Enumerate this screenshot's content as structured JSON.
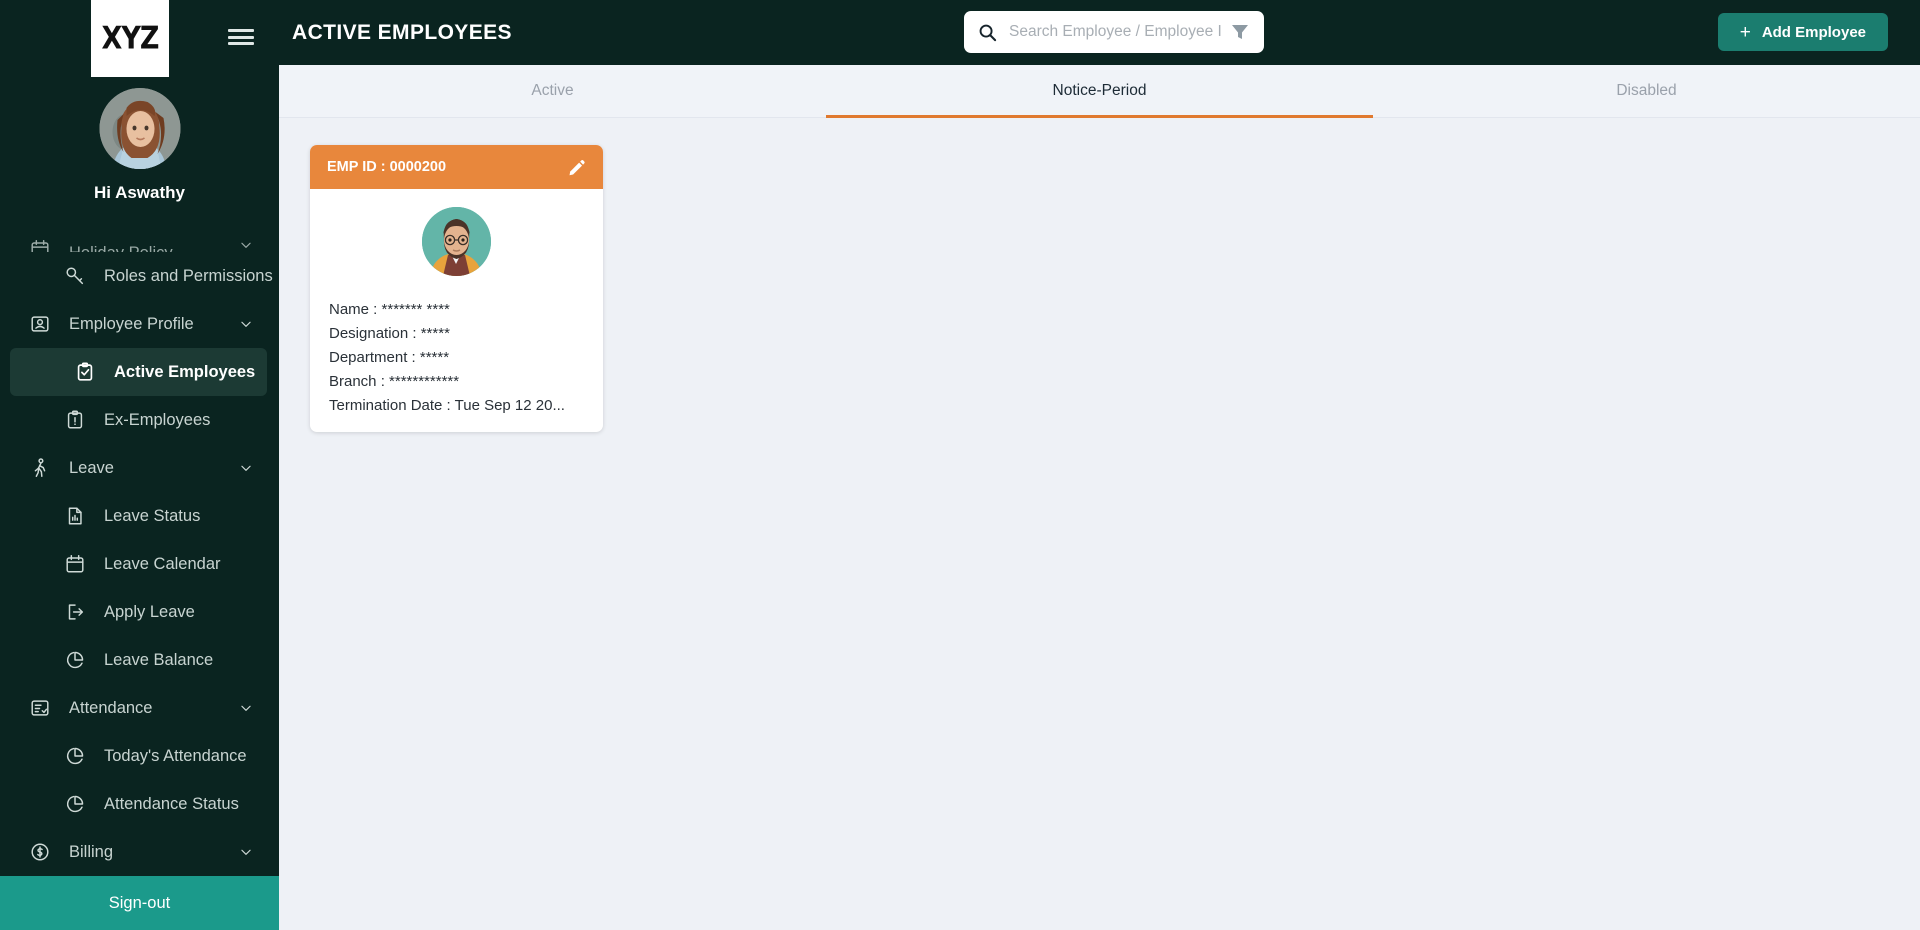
{
  "brand": {
    "logo_text": "XYZ"
  },
  "sidebar": {
    "greeting": "Hi Aswathy",
    "items": [
      {
        "label": "Holiday Policy",
        "icon": "calendar-icon",
        "level": "parent",
        "state": "clipped",
        "chevron": true
      },
      {
        "label": "Roles and Permissions",
        "icon": "key-icon",
        "level": "child",
        "state": "normal",
        "chevron": false
      },
      {
        "label": "Employee Profile",
        "icon": "id-card-icon",
        "level": "parent",
        "state": "normal",
        "chevron": true
      },
      {
        "label": "Active Employees",
        "icon": "clipboard-check-icon",
        "level": "child",
        "state": "active",
        "chevron": false
      },
      {
        "label": "Ex-Employees",
        "icon": "clipboard-alert-icon",
        "level": "child",
        "state": "normal",
        "chevron": false
      },
      {
        "label": "Leave",
        "icon": "walking-person-icon",
        "level": "parent",
        "state": "normal",
        "chevron": true
      },
      {
        "label": "Leave Status",
        "icon": "document-chart-icon",
        "level": "child",
        "state": "normal",
        "chevron": false
      },
      {
        "label": "Leave Calendar",
        "icon": "calendar-icon",
        "level": "child",
        "state": "normal",
        "chevron": false
      },
      {
        "label": "Apply Leave",
        "icon": "exit-arrow-icon",
        "level": "child",
        "state": "normal",
        "chevron": false
      },
      {
        "label": "Leave Balance",
        "icon": "pie-chart-icon",
        "level": "child",
        "state": "normal",
        "chevron": false
      },
      {
        "label": "Attendance",
        "icon": "list-check-icon",
        "level": "parent",
        "state": "normal",
        "chevron": true
      },
      {
        "label": "Today's Attendance",
        "icon": "pie-chart-icon",
        "level": "child",
        "state": "normal",
        "chevron": false
      },
      {
        "label": "Attendance Status",
        "icon": "pie-chart-icon",
        "level": "child",
        "state": "normal",
        "chevron": false
      },
      {
        "label": "Billing",
        "icon": "dollar-circle-icon",
        "level": "parent",
        "state": "normal",
        "chevron": true
      }
    ],
    "signout_label": "Sign-out"
  },
  "header": {
    "title": "ACTIVE EMPLOYEES",
    "menu_icon": "hamburger-icon",
    "search": {
      "placeholder": "Search Employee / Employee I",
      "value": "",
      "search_icon": "search-icon",
      "filter_icon": "filter-icon"
    },
    "add_button": {
      "label": "Add Employee",
      "plus": "+"
    }
  },
  "tabs": [
    {
      "label": "Active",
      "active": false
    },
    {
      "label": "Notice-Period",
      "active": true
    },
    {
      "label": "Disabled",
      "active": false
    }
  ],
  "employee_cards": [
    {
      "emp_id_label": "EMP ID : 0000200",
      "edit_icon": "pencil-icon",
      "fields": [
        "Name : ******* ****",
        "Designation : *****",
        "Department : *****",
        "Branch : ************",
        "Termination Date : Tue Sep 12 20..."
      ]
    }
  ],
  "colors": {
    "sidebar_bg": "#0a2420",
    "accent_teal": "#1b7d6f",
    "signout_teal": "#1b9a8b",
    "card_orange": "#e8873c",
    "tab_underline": "#e0792f",
    "content_bg": "#eef1f6"
  }
}
